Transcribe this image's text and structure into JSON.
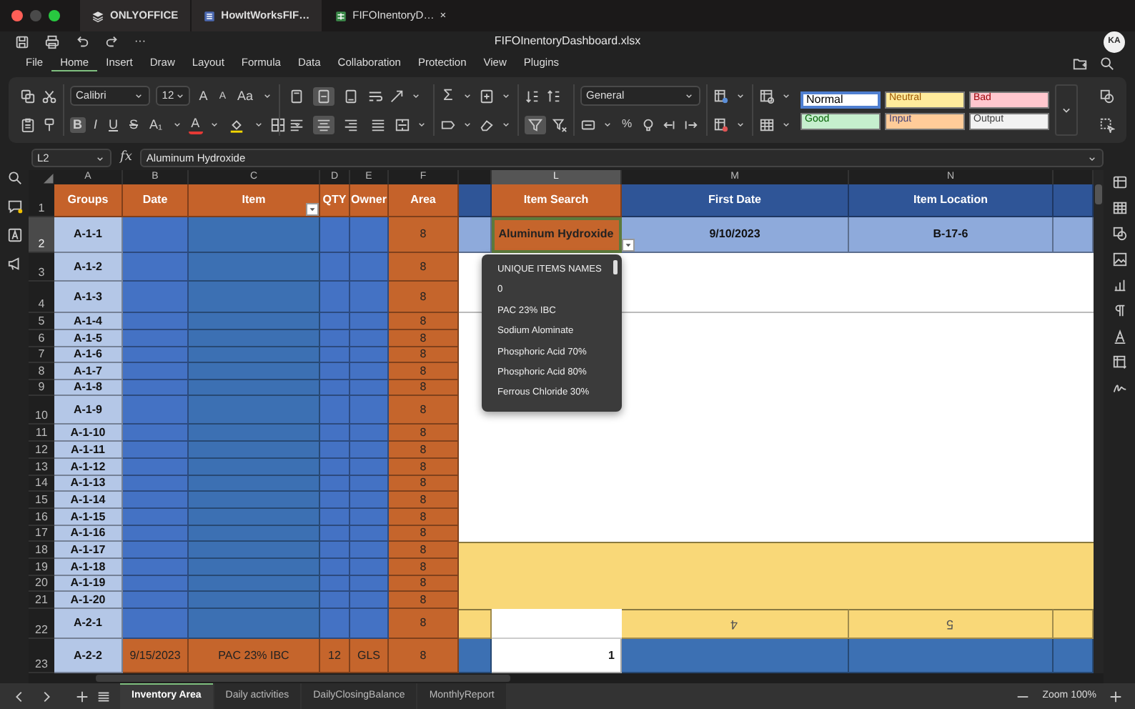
{
  "window": {
    "tabs": [
      {
        "label": "ONLYOFFICE",
        "kind": "home",
        "selected": false
      },
      {
        "label": "HowItWorksFIF…",
        "kind": "document",
        "selected": false
      },
      {
        "label": "FIFOInentoryD…",
        "kind": "spreadsheet",
        "selected": true,
        "close": "×"
      }
    ],
    "more": "···",
    "title": "FIFOInentoryDashboard.xlsx",
    "avatar": "KA"
  },
  "menu": [
    {
      "label": "File",
      "selected": false
    },
    {
      "label": "Home",
      "selected": true
    },
    {
      "label": "Insert",
      "selected": false
    },
    {
      "label": "Draw",
      "selected": false
    },
    {
      "label": "Layout",
      "selected": false
    },
    {
      "label": "Formula",
      "selected": false
    },
    {
      "label": "Data",
      "selected": false
    },
    {
      "label": "Collaboration",
      "selected": false
    },
    {
      "label": "Protection",
      "selected": false
    },
    {
      "label": "View",
      "selected": false
    },
    {
      "label": "Plugins",
      "selected": false
    }
  ],
  "ribbon": {
    "font": "Calibri",
    "font_size": "12",
    "number_format": "General",
    "sum": "Σ",
    "percent": "%",
    "font_buttons": [
      {
        "label": "A",
        "kind": "grow"
      },
      {
        "label": "A",
        "kind": "shrink"
      },
      {
        "label": "Aa",
        "kind": "case"
      }
    ],
    "format_buttons": [
      {
        "label": "B",
        "kind": "bold",
        "on": true
      },
      {
        "label": "I",
        "kind": "italic",
        "on": false
      },
      {
        "label": "U",
        "kind": "underline",
        "on": false
      },
      {
        "label": "S",
        "kind": "strike",
        "on": false
      },
      {
        "label": "A₁",
        "kind": "subscript",
        "on": false
      }
    ],
    "font_color": {
      "label": "A",
      "color": "#e53935"
    },
    "fill_color": {
      "color": "#f2d600"
    },
    "vertical_align": [
      {
        "kind": "top",
        "on": false
      },
      {
        "kind": "middle",
        "on": true
      },
      {
        "kind": "bottom",
        "on": false
      }
    ],
    "horizontal_align": [
      {
        "kind": "left",
        "on": false
      },
      {
        "kind": "center",
        "on": true
      },
      {
        "kind": "right",
        "on": false
      },
      {
        "kind": "justify",
        "on": false
      }
    ],
    "filter_on": true,
    "styles": [
      {
        "label": "Normal",
        "kind": "normal",
        "color": "#ffffff",
        "selected": true
      },
      {
        "label": "Neutral",
        "kind": "neutral",
        "color": "#ffeb9c",
        "selected": false
      },
      {
        "label": "Bad",
        "kind": "bad",
        "color": "#ffc7ce",
        "selected": false
      },
      {
        "label": "Good",
        "kind": "good",
        "color": "#c6efce",
        "selected": false
      },
      {
        "label": "Input",
        "kind": "input",
        "color": "#ffcc99",
        "selected": false
      },
      {
        "label": "Output",
        "kind": "output",
        "color": "#f2f2f2",
        "selected": false
      }
    ]
  },
  "formula_bar": {
    "cell": "L2",
    "fx": "fx",
    "value": "Aluminum Hydroxide"
  },
  "columns": [
    {
      "label": "A",
      "selected": false
    },
    {
      "label": "B",
      "selected": false
    },
    {
      "label": "C",
      "selected": false
    },
    {
      "label": "D",
      "selected": false
    },
    {
      "label": "E",
      "selected": false
    },
    {
      "label": "F",
      "selected": false
    },
    {
      "label": "L",
      "selected": true
    },
    {
      "label": "M",
      "selected": false
    },
    {
      "label": "N",
      "selected": false
    }
  ],
  "rows": [
    {
      "number": "1",
      "kind": "header",
      "selected": false,
      "group": "Groups",
      "date": "Date",
      "item": "Item",
      "qty": "QTY",
      "owner": "Owner",
      "area": "Area"
    },
    {
      "number": "2",
      "kind": "empty",
      "selected": true,
      "group": "A-1-1",
      "area": "8"
    },
    {
      "number": "3",
      "kind": "empty",
      "selected": false,
      "group": "A-1-2",
      "area": "8"
    },
    {
      "number": "4",
      "kind": "empty",
      "selected": false,
      "group": "A-1-3",
      "area": "8"
    },
    {
      "number": "5",
      "kind": "empty",
      "selected": false,
      "group": "A-1-4",
      "area": "8"
    },
    {
      "number": "6",
      "kind": "empty",
      "selected": false,
      "group": "A-1-5",
      "area": "8"
    },
    {
      "number": "7",
      "kind": "empty",
      "selected": false,
      "group": "A-1-6",
      "area": "8"
    },
    {
      "number": "8",
      "kind": "empty",
      "selected": false,
      "group": "A-1-7",
      "area": "8"
    },
    {
      "number": "9",
      "kind": "empty",
      "selected": false,
      "group": "A-1-8",
      "area": "8"
    },
    {
      "number": "10",
      "kind": "empty",
      "selected": false,
      "group": "A-1-9",
      "area": "8"
    },
    {
      "number": "11",
      "kind": "empty",
      "selected": false,
      "group": "A-1-10",
      "area": "8"
    },
    {
      "number": "12",
      "kind": "empty",
      "selected": false,
      "group": "A-1-11",
      "area": "8"
    },
    {
      "number": "13",
      "kind": "empty",
      "selected": false,
      "group": "A-1-12",
      "area": "8"
    },
    {
      "number": "14",
      "kind": "empty",
      "selected": false,
      "group": "A-1-13",
      "area": "8"
    },
    {
      "number": "15",
      "kind": "empty",
      "selected": false,
      "group": "A-1-14",
      "area": "8"
    },
    {
      "number": "16",
      "kind": "empty",
      "selected": false,
      "group": "A-1-15",
      "area": "8"
    },
    {
      "number": "17",
      "kind": "empty",
      "selected": false,
      "group": "A-1-16",
      "area": "8"
    },
    {
      "number": "18",
      "kind": "empty",
      "selected": false,
      "group": "A-1-17",
      "area": "8"
    },
    {
      "number": "19",
      "kind": "empty",
      "selected": false,
      "group": "A-1-18",
      "area": "8"
    },
    {
      "number": "20",
      "kind": "empty",
      "selected": false,
      "group": "A-1-19",
      "area": "8"
    },
    {
      "number": "21",
      "kind": "empty",
      "selected": false,
      "group": "A-1-20",
      "area": "8"
    },
    {
      "number": "22",
      "kind": "empty",
      "selected": false,
      "group": "A-2-1",
      "area": "8"
    },
    {
      "number": "23",
      "kind": "filled",
      "selected": false,
      "group": "A-2-2",
      "date": "9/15/2023",
      "item": "PAC 23% IBC",
      "qty": "12",
      "owner": "GLS",
      "area": "8"
    }
  ],
  "lookup": {
    "headers": [
      "Item Search",
      "First Date",
      "Item Location"
    ],
    "values": [
      "Aluminum Hydroxide",
      "9/10/2023",
      "B-17-6"
    ],
    "bins": [
      "4",
      "5"
    ],
    "count": "1"
  },
  "dropdown": {
    "items": [
      "UNIQUE ITEMS NAMES",
      "0",
      "PAC 23% IBC",
      "Sodium Alominate",
      "Phosphoric Acid 70%",
      "Phosphoric Acid 80%",
      "Ferrous Chloride 30%"
    ]
  },
  "sheets": [
    {
      "label": "Inventory Area",
      "selected": true
    },
    {
      "label": "Daily activities",
      "selected": false
    },
    {
      "label": "DailyClosingBalance",
      "selected": false
    },
    {
      "label": "MonthlyReport",
      "selected": false
    }
  ],
  "zoom": "Zoom 100%"
}
